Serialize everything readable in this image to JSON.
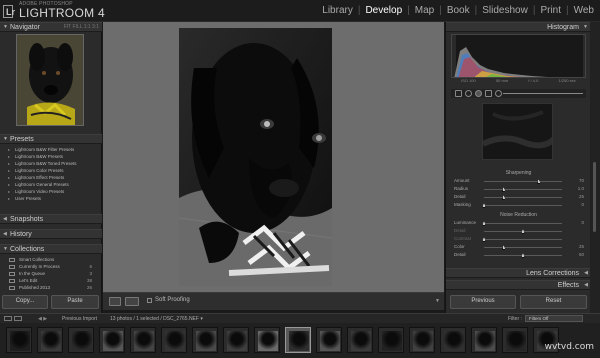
{
  "header": {
    "brand_small": "ADOBE PHOTOSHOP",
    "brand_big": "LIGHTROOM 4",
    "modules": [
      "Library",
      "Develop",
      "Map",
      "Book",
      "Slideshow",
      "Print",
      "Web"
    ],
    "active_module": "Develop"
  },
  "left": {
    "navigator": {
      "title": "Navigator",
      "options": "FIT  FILL  1:1  3:1"
    },
    "presets": {
      "title": "Presets",
      "items": [
        "Lightroom B&W Filter Presets",
        "Lightroom B&W Presets",
        "Lightroom B&W Toned Presets",
        "Lightroom Color Presets",
        "Lightroom Effect Presets",
        "Lightroom General Presets",
        "Lightroom Video Presets",
        "User Presets"
      ]
    },
    "snapshots": {
      "title": "Snapshots"
    },
    "history": {
      "title": "History"
    },
    "collections": {
      "title": "Collections",
      "items": [
        {
          "label": "Smart Collections",
          "count": ""
        },
        {
          "label": "Currently In Process",
          "count": "6"
        },
        {
          "label": "In the Queue",
          "count": "3"
        },
        {
          "label": "Let's Edit",
          "count": "38"
        },
        {
          "label": "Published 2013",
          "count": "26"
        }
      ]
    },
    "copy_label": "Copy...",
    "paste_label": "Paste"
  },
  "toolbar": {
    "soft_proofing_label": "Soft Proofing"
  },
  "right": {
    "histogram": {
      "title": "Histogram",
      "info": [
        "ISO 100",
        "50 mm",
        "f / 4.0",
        "1/250 sec"
      ]
    },
    "sharpening": {
      "title": "Sharpening",
      "rows": [
        {
          "label": "Amount",
          "value": "70",
          "pos": 0.7
        },
        {
          "label": "Radius",
          "value": "1.0",
          "pos": 0.25
        },
        {
          "label": "Detail",
          "value": "25",
          "pos": 0.25
        },
        {
          "label": "Masking",
          "value": "0",
          "pos": 0.0
        }
      ]
    },
    "noise_reduction": {
      "title": "Noise Reduction",
      "rows": [
        {
          "label": "Luminance",
          "value": "0",
          "pos": 0.0,
          "dim": false
        },
        {
          "label": "Detail",
          "value": "",
          "pos": 0.5,
          "dim": true
        },
        {
          "label": "Contrast",
          "value": "",
          "pos": 0.0,
          "dim": true
        },
        {
          "label": "Color",
          "value": "25",
          "pos": 0.25,
          "dim": false
        },
        {
          "label": "Detail",
          "value": "50",
          "pos": 0.5,
          "dim": false
        }
      ]
    },
    "lens_corrections": {
      "title": "Lens Corrections"
    },
    "effects": {
      "title": "Effects"
    },
    "previous_label": "Previous",
    "reset_label": "Reset"
  },
  "filmstrip": {
    "source": "Previous Import",
    "selection": "13 photos / 1 selected / DSC_2765.NEF ▾",
    "filter_label": "Filter :",
    "filter_value": "Filters Off"
  },
  "watermark": "wvtvd.com"
}
